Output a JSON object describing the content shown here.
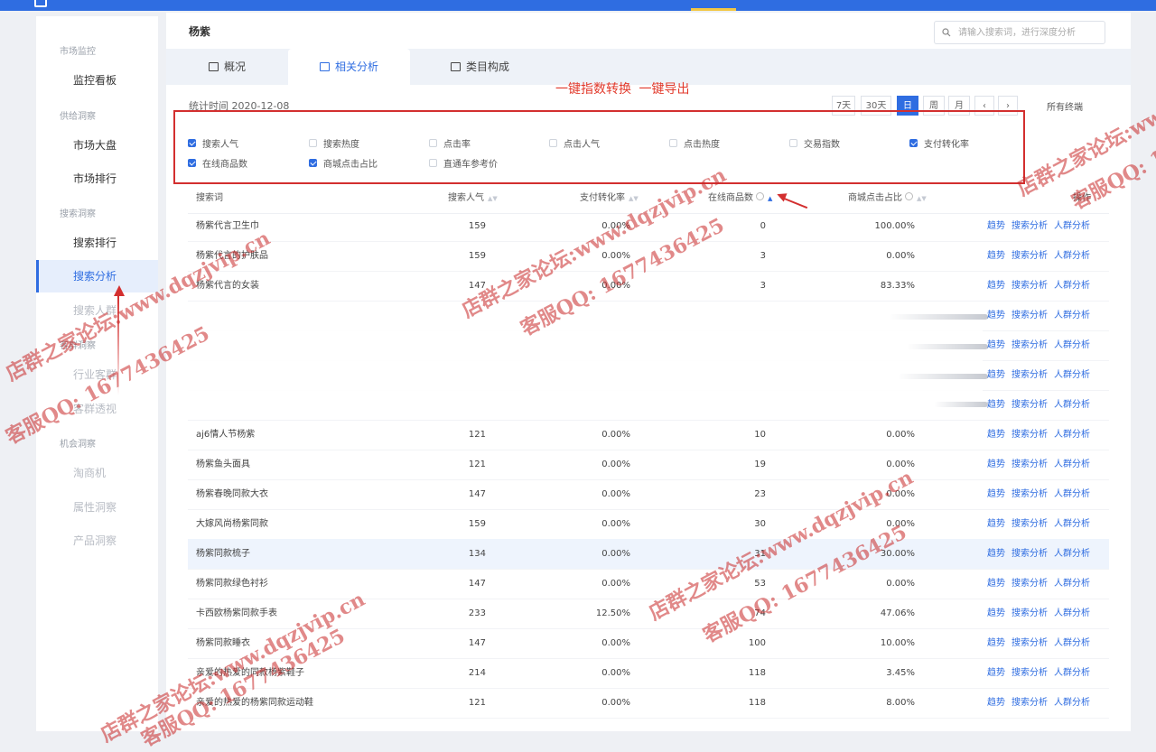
{
  "colors": {
    "primary": "#2f6de1",
    "annotation": "#d32f2f",
    "accent_bar": "#f2c744"
  },
  "sidebar": {
    "sections": [
      {
        "title": "市场监控",
        "items": [
          {
            "label": "监控看板",
            "state": "normal"
          }
        ]
      },
      {
        "title": "供给洞察",
        "items": [
          {
            "label": "市场大盘",
            "state": "normal"
          },
          {
            "label": "市场排行",
            "state": "normal"
          }
        ]
      },
      {
        "title": "搜索洞察",
        "items": [
          {
            "label": "搜索排行",
            "state": "normal"
          },
          {
            "label": "搜索分析",
            "state": "active"
          },
          {
            "label": "搜索人群",
            "state": "faded"
          }
        ]
      },
      {
        "title": "客群洞察",
        "items": [
          {
            "label": "行业客群",
            "state": "faded"
          },
          {
            "label": "客群透视",
            "state": "faded"
          }
        ]
      },
      {
        "title": "机会洞察",
        "items": [
          {
            "label": "淘商机",
            "state": "faded"
          },
          {
            "label": "属性洞察",
            "state": "faded"
          },
          {
            "label": "产品洞察",
            "state": "faded"
          }
        ]
      }
    ]
  },
  "header": {
    "title": "杨紫",
    "search_placeholder": "请输入搜索词，进行深度分析",
    "search_icon": "search-icon"
  },
  "tabs": [
    {
      "label": "概况",
      "icon": "tab-icon",
      "active": false
    },
    {
      "label": "相关分析",
      "icon": "tab-icon",
      "active": true
    },
    {
      "label": "类目构成",
      "icon": "tab-icon",
      "active": false
    }
  ],
  "stat_date": "统计时间 2020-12-08",
  "annotation_banner": "一键指数转换 一键导出",
  "periods": [
    {
      "label": "7天",
      "active": false
    },
    {
      "label": "30天",
      "active": false
    },
    {
      "label": "日",
      "active": true
    },
    {
      "label": "周",
      "active": false
    },
    {
      "label": "月",
      "active": false
    },
    {
      "label": "‹",
      "active": false
    },
    {
      "label": "›",
      "active": false
    }
  ],
  "terminal_select": "所有终端",
  "metrics": [
    {
      "label": "搜索人气",
      "checked": true
    },
    {
      "label": "搜索热度",
      "checked": false
    },
    {
      "label": "点击率",
      "checked": false
    },
    {
      "label": "点击人气",
      "checked": false
    },
    {
      "label": "点击热度",
      "checked": false
    },
    {
      "label": "交易指数",
      "checked": false
    },
    {
      "label": "支付转化率",
      "checked": true
    },
    {
      "label": "在线商品数",
      "checked": true
    },
    {
      "label": "商城点击占比",
      "checked": true
    },
    {
      "label": "直通车参考价",
      "checked": false
    }
  ],
  "table": {
    "headers": {
      "keyword": "搜索词",
      "popularity": "搜索人气",
      "conversion": "支付转化率",
      "products": "在线商品数",
      "mall_share": "商城点击占比",
      "ops": "操作"
    },
    "ops_labels": [
      "趋势",
      "搜索分析",
      "人群分析"
    ],
    "rows": [
      {
        "keyword": "杨紫代言卫生巾",
        "popularity": "159",
        "conversion": "0.00%",
        "products": "0",
        "mall_share": "100.00%"
      },
      {
        "keyword": "杨紫代言的护肤品",
        "popularity": "159",
        "conversion": "0.00%",
        "products": "3",
        "mall_share": "0.00%"
      },
      {
        "keyword": "杨紫代言的女装",
        "popularity": "147",
        "conversion": "0.00%",
        "products": "3",
        "mall_share": "83.33%"
      },
      {
        "keyword": "",
        "popularity": "",
        "conversion": "",
        "products": "",
        "mall_share": ""
      },
      {
        "keyword": "",
        "popularity": "",
        "conversion": "",
        "products": "",
        "mall_share": ""
      },
      {
        "keyword": "",
        "popularity": "",
        "conversion": "",
        "products": "",
        "mall_share": ""
      },
      {
        "keyword": "",
        "popularity": "",
        "conversion": "",
        "products": "",
        "mall_share": ""
      },
      {
        "keyword": "aj6情人节杨紫",
        "popularity": "121",
        "conversion": "0.00%",
        "products": "10",
        "mall_share": "0.00%"
      },
      {
        "keyword": "杨紫鱼头面具",
        "popularity": "121",
        "conversion": "0.00%",
        "products": "19",
        "mall_share": "0.00%"
      },
      {
        "keyword": "杨紫春晚同款大衣",
        "popularity": "147",
        "conversion": "0.00%",
        "products": "23",
        "mall_share": "0.00%"
      },
      {
        "keyword": "大嫁风尚杨紫同款",
        "popularity": "159",
        "conversion": "0.00%",
        "products": "30",
        "mall_share": "0.00%"
      },
      {
        "keyword": "杨紫同款梳子",
        "popularity": "134",
        "conversion": "0.00%",
        "products": "31",
        "mall_share": "30.00%",
        "highlight": true
      },
      {
        "keyword": "杨紫同款绿色衬衫",
        "popularity": "147",
        "conversion": "0.00%",
        "products": "53",
        "mall_share": "0.00%"
      },
      {
        "keyword": "卡西欧杨紫同款手表",
        "popularity": "233",
        "conversion": "12.50%",
        "products": "74",
        "mall_share": "47.06%"
      },
      {
        "keyword": "杨紫同款睡衣",
        "popularity": "147",
        "conversion": "0.00%",
        "products": "100",
        "mall_share": "10.00%"
      },
      {
        "keyword": "亲爱的热爱的同款杨紫鞋子",
        "popularity": "214",
        "conversion": "0.00%",
        "products": "118",
        "mall_share": "3.45%"
      },
      {
        "keyword": "亲爱的热爱的杨紫同款运动鞋",
        "popularity": "121",
        "conversion": "0.00%",
        "products": "118",
        "mall_share": "8.00%"
      }
    ]
  },
  "watermarks": [
    "店群之家论坛:www.dqzjvip.cn",
    "客服QQ: 1677436425"
  ]
}
